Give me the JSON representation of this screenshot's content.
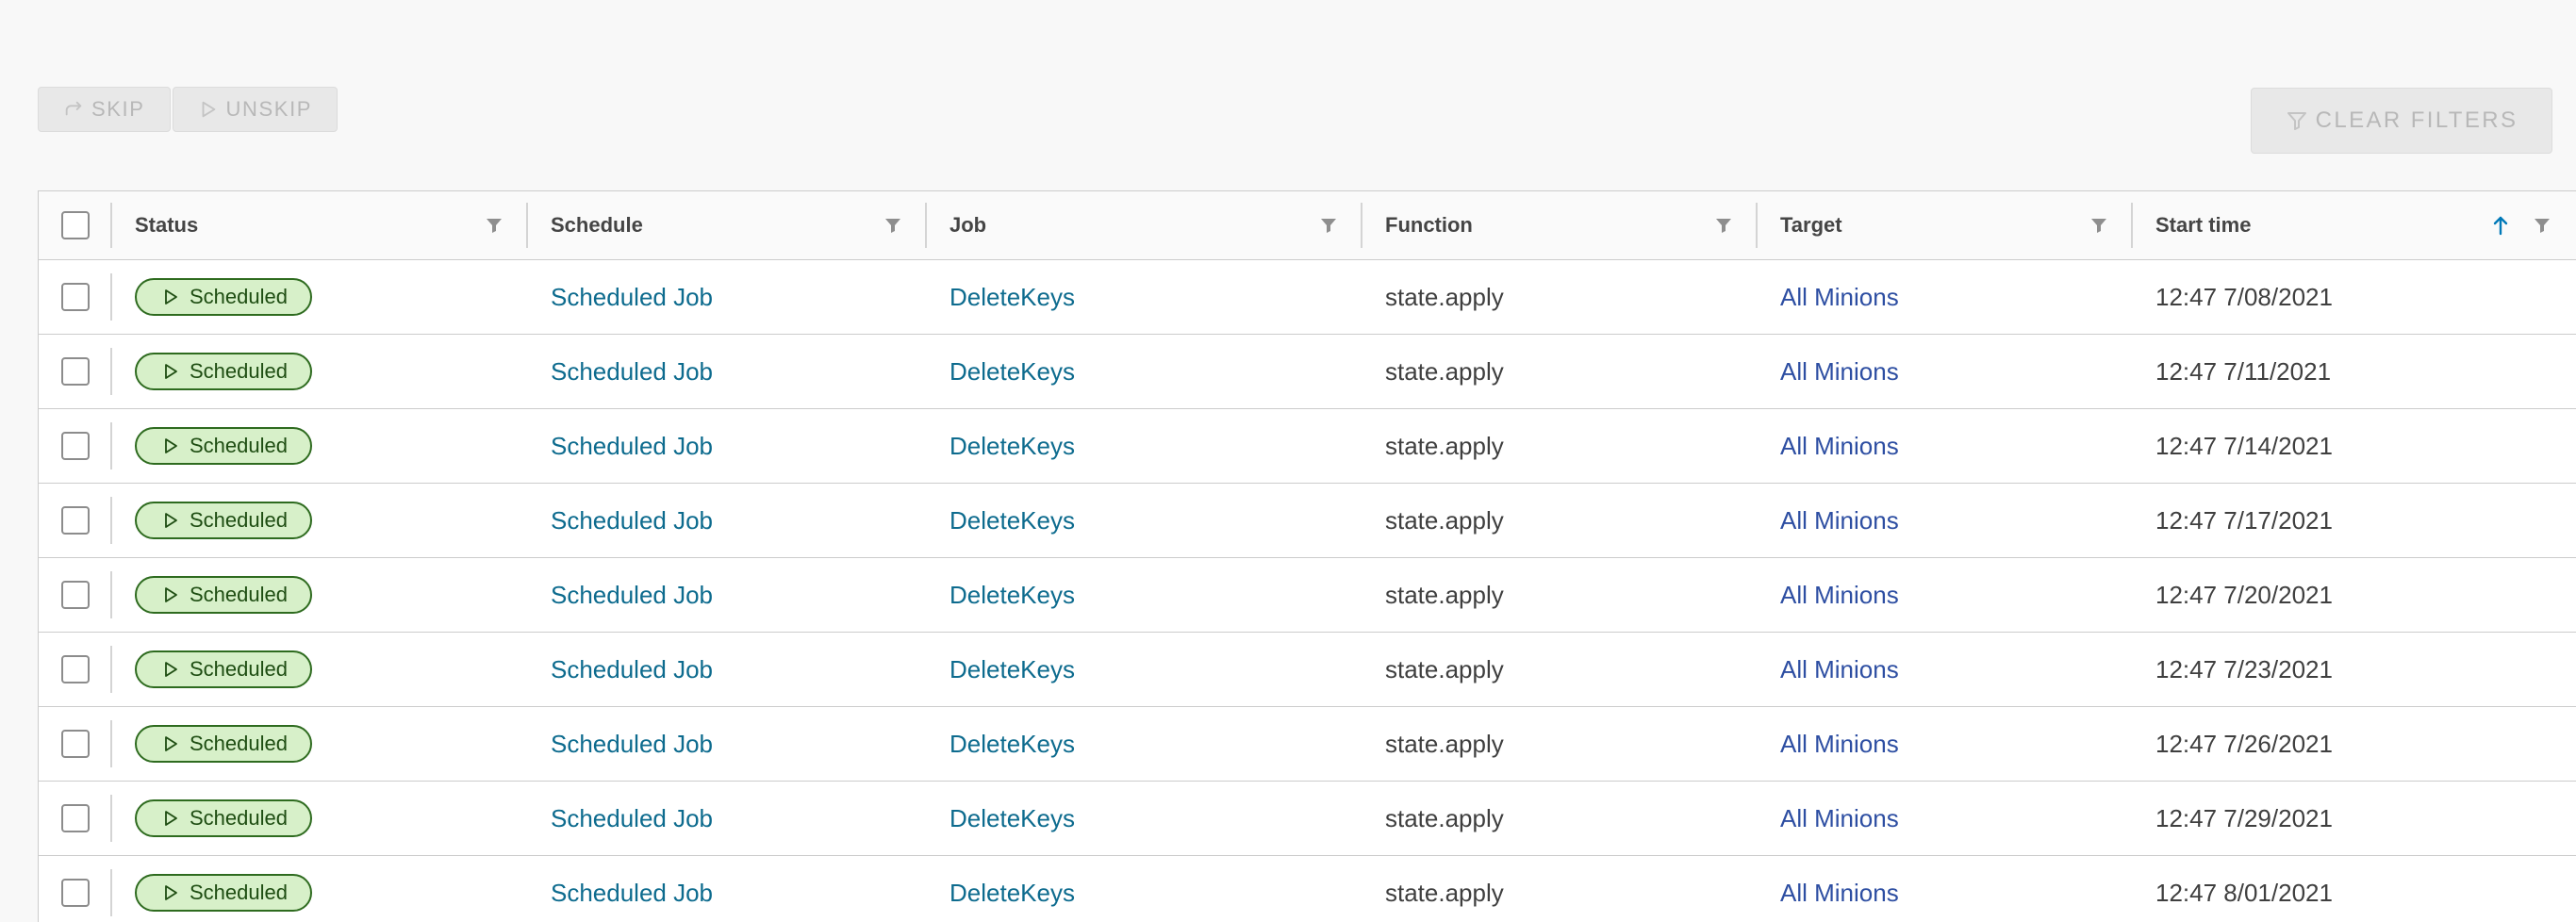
{
  "toolbar": {
    "skip_label": "SKIP",
    "unskip_label": "UNSKIP",
    "clear_filters_label": "CLEAR FILTERS"
  },
  "table": {
    "columns": {
      "status": "Status",
      "schedule": "Schedule",
      "job": "Job",
      "function": "Function",
      "target": "Target",
      "start_time": "Start time"
    },
    "sort": {
      "column": "Start time",
      "direction": "ascending"
    },
    "rows": [
      {
        "status": "Scheduled",
        "schedule": "Scheduled Job",
        "job": "DeleteKeys",
        "function": "state.apply",
        "target": "All Minions",
        "start_time": "12:47 7/08/2021"
      },
      {
        "status": "Scheduled",
        "schedule": "Scheduled Job",
        "job": "DeleteKeys",
        "function": "state.apply",
        "target": "All Minions",
        "start_time": "12:47 7/11/2021"
      },
      {
        "status": "Scheduled",
        "schedule": "Scheduled Job",
        "job": "DeleteKeys",
        "function": "state.apply",
        "target": "All Minions",
        "start_time": "12:47 7/14/2021"
      },
      {
        "status": "Scheduled",
        "schedule": "Scheduled Job",
        "job": "DeleteKeys",
        "function": "state.apply",
        "target": "All Minions",
        "start_time": "12:47 7/17/2021"
      },
      {
        "status": "Scheduled",
        "schedule": "Scheduled Job",
        "job": "DeleteKeys",
        "function": "state.apply",
        "target": "All Minions",
        "start_time": "12:47 7/20/2021"
      },
      {
        "status": "Scheduled",
        "schedule": "Scheduled Job",
        "job": "DeleteKeys",
        "function": "state.apply",
        "target": "All Minions",
        "start_time": "12:47 7/23/2021"
      },
      {
        "status": "Scheduled",
        "schedule": "Scheduled Job",
        "job": "DeleteKeys",
        "function": "state.apply",
        "target": "All Minions",
        "start_time": "12:47 7/26/2021"
      },
      {
        "status": "Scheduled",
        "schedule": "Scheduled Job",
        "job": "DeleteKeys",
        "function": "state.apply",
        "target": "All Minions",
        "start_time": "12:47 7/29/2021"
      },
      {
        "status": "Scheduled",
        "schedule": "Scheduled Job",
        "job": "DeleteKeys",
        "function": "state.apply",
        "target": "All Minions",
        "start_time": "12:47 8/01/2021"
      }
    ]
  },
  "colors": {
    "link_teal": "#0d6b8e",
    "link_blue": "#2d4ea2",
    "badge_bg": "#d7f0c9",
    "badge_border": "#2e6b1f",
    "sort_icon": "#0079b8",
    "disabled_text": "#b8b8b8"
  },
  "icons": {
    "skip": "redo-arrow-icon",
    "unskip": "play-outline-icon",
    "clear_filters": "filter-outline-icon",
    "column_filter": "filter-icon",
    "sort": "arrow-up-icon",
    "status": "play-outline-icon"
  }
}
